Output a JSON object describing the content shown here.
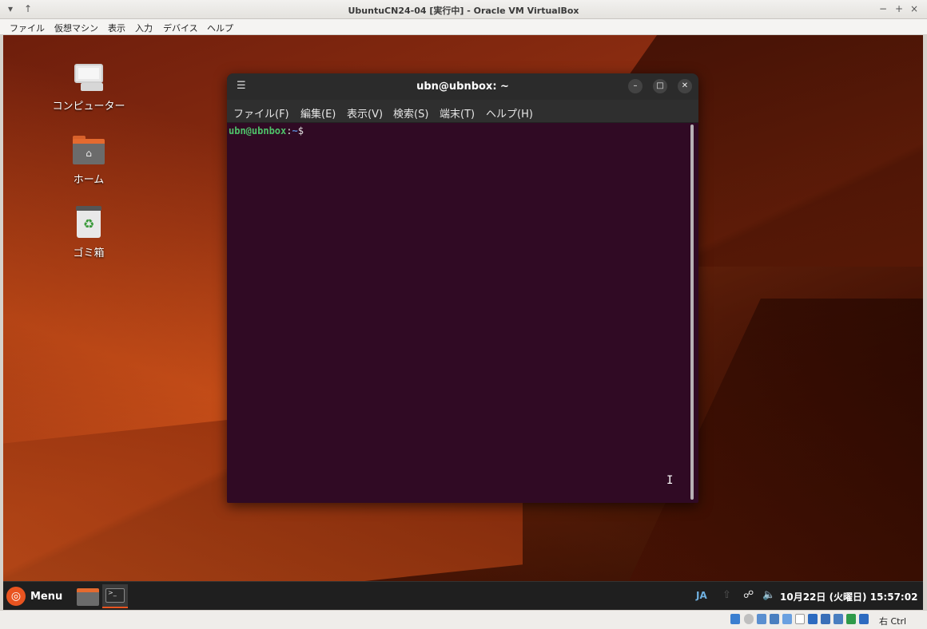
{
  "host": {
    "title": "UbuntuCN24-04 [実行中] - Oracle VM VirtualBox",
    "left_controls": [
      "▾",
      "↑"
    ],
    "right_controls": [
      "−",
      "+",
      "×"
    ],
    "menu": [
      "ファイル",
      "仮想マシン",
      "表示",
      "入力",
      "デバイス",
      "ヘルプ"
    ],
    "host_key": "右 Ctrl"
  },
  "desktop": {
    "icons": [
      {
        "label": "コンピューター",
        "icon": "computer-icon"
      },
      {
        "label": "ホーム",
        "icon": "home-folder-icon"
      },
      {
        "label": "ゴミ箱",
        "icon": "trash-icon"
      }
    ]
  },
  "terminal": {
    "title": "ubn@ubnbox: ~",
    "menu": [
      "ファイル(F)",
      "編集(E)",
      "表示(V)",
      "検索(S)",
      "端末(T)",
      "ヘルプ(H)"
    ],
    "prompt": {
      "user": "ubn@ubnbox",
      "sep": ":",
      "path": "~",
      "symbol": "$"
    }
  },
  "panel": {
    "menu_label": "Menu",
    "input_method": "JA",
    "clock": "10月22日 (火曜日) 15:57:02"
  },
  "colors": {
    "terminal_bg": "#300a24",
    "ubuntu_orange": "#e95420"
  }
}
